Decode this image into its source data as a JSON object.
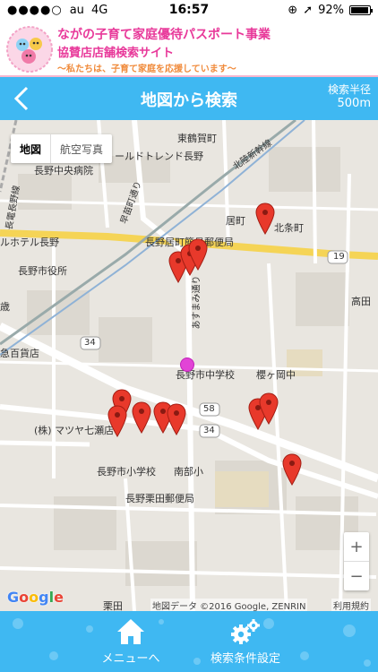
{
  "status": {
    "carrier": "au",
    "network": "4G",
    "time": "16:57",
    "battery": "92%"
  },
  "brand": {
    "title_line1": "ながの子育て家庭優待パスポート事業",
    "title_line2": "協賛店店舗検索サイト",
    "tagline": "〜私たちは、子育て家庭を応援しています〜"
  },
  "navbar": {
    "title": "地図から検索",
    "radius_label": "検索半径",
    "radius_value": "500m"
  },
  "map": {
    "type_options": [
      "地図",
      "航空写真"
    ],
    "labels": {
      "higashi_tsurugamachi": "東鶴賀町",
      "world_trend": "ールドトレンド長野",
      "hokuriku": "北陸新幹線",
      "chuo_hospital": "長野中央病院",
      "nagano_dentetsu": "長電長野線",
      "wasedamachi": "早苗町通り",
      "imachi": "居町",
      "kitajomachi": "北条町",
      "hotel_nagano": "ルホテル長野",
      "post_office_1": "長野居町簡易郵便局",
      "city_hall": "長野市役所",
      "route19": "19",
      "takada": "高田",
      "sai": "歳",
      "asuka_road": "あすまみ通り",
      "hyakkaten": "急百貨店",
      "route34": "34",
      "route58": "58",
      "middle_school": "長野市中学校",
      "sakuragaoka": "櫻ヶ岡中",
      "matsuya": "(株) マツヤ七瀬店",
      "elementary": "長野市小学校",
      "nanbu": "南部小",
      "post_office_2": "長野栗田郵便局",
      "kurita": "栗田"
    },
    "attribution": "地図データ ©2016 Google, ZENRIN",
    "terms": "利用規約",
    "zoom_in": "+",
    "zoom_out": "−",
    "google": "Google"
  },
  "tabbar": {
    "menu_label": "メニューへ",
    "search_settings_label": "検索条件設定"
  },
  "colors": {
    "accent": "#3fb8f2",
    "brand_pink": "#e8399a",
    "pin_red": "#e8392b",
    "me_marker": "#e244d6"
  },
  "icons": {
    "back": "chevron-left-icon",
    "home": "home-icon",
    "settings": "gears-icon"
  }
}
